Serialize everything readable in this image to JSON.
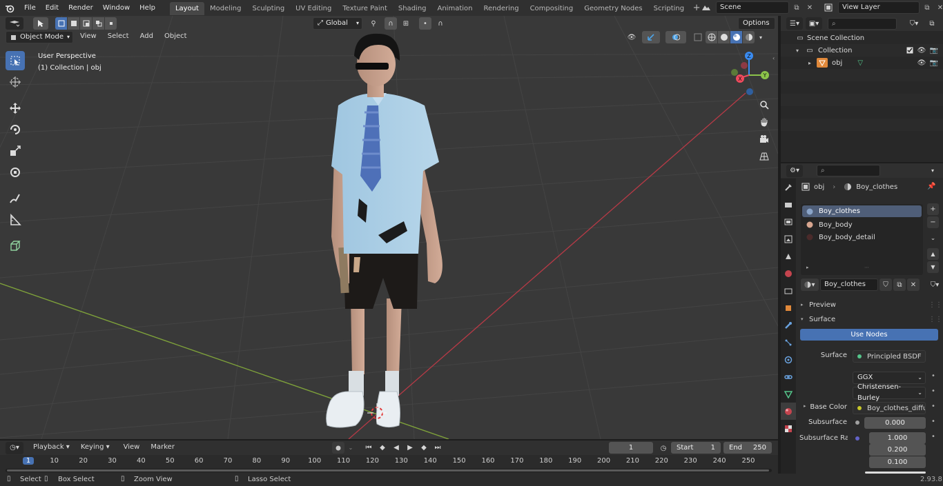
{
  "topbar": {
    "menus": [
      "File",
      "Edit",
      "Render",
      "Window",
      "Help"
    ],
    "workspaces": [
      "Layout",
      "Modeling",
      "Sculpting",
      "UV Editing",
      "Texture Paint",
      "Shading",
      "Animation",
      "Rendering",
      "Compositing",
      "Geometry Nodes",
      "Scripting"
    ],
    "active_workspace": "Layout",
    "scene": "Scene",
    "view_layer": "View Layer"
  },
  "viewport": {
    "mode": "Object Mode",
    "menus": [
      "View",
      "Select",
      "Add",
      "Object"
    ],
    "transform_orientation": "Global",
    "options_label": "Options",
    "overlay_title": "User Perspective",
    "overlay_sub": "(1) Collection | obj",
    "gizmo_axes": {
      "x": "X",
      "y": "Y",
      "z": "Z"
    },
    "tools": [
      "select-box",
      "cursor",
      "move",
      "rotate",
      "scale",
      "transform",
      "annotate",
      "measure",
      "add-cube"
    ]
  },
  "outliner": {
    "root": "Scene Collection",
    "collection": "Collection",
    "object": "obj"
  },
  "properties": {
    "breadcrumb_object": "obj",
    "breadcrumb_material": "Boy_clothes",
    "slots": [
      "Boy_clothes",
      "Boy_body",
      "Boy_body_detail"
    ],
    "material_name": "Boy_clothes",
    "preview_label": "Preview",
    "surface_label": "Surface",
    "use_nodes": "Use Nodes",
    "surface_field_label": "Surface",
    "surface_value": "Principled BSDF",
    "distribution": "GGX",
    "subsurface_method": "Christensen-Burley",
    "base_color_label": "Base Color",
    "base_color_value": "Boy_clothes_diffuse...",
    "subsurface_label": "Subsurface",
    "subsurface_value": "0.000",
    "subsurface_radius_label": "Subsurface Radi...",
    "radius": [
      "1.000",
      "0.200",
      "0.100"
    ]
  },
  "timeline": {
    "menus": [
      "Playback",
      "Keying",
      "View",
      "Marker"
    ],
    "current_frame": "1",
    "start_label": "Start",
    "start": "1",
    "end_label": "End",
    "end": "250",
    "ruler": [
      "1",
      "10",
      "20",
      "30",
      "40",
      "50",
      "60",
      "70",
      "80",
      "90",
      "100",
      "110",
      "120",
      "130",
      "140",
      "150",
      "160",
      "170",
      "180",
      "190",
      "200",
      "210",
      "220",
      "230",
      "240",
      "250"
    ]
  },
  "status": {
    "items": [
      "Select",
      "Box Select",
      "Zoom View",
      "Lasso Select"
    ],
    "version": "2.93.8"
  },
  "colors": {
    "accent": "#4772b3",
    "x_axis": "#f04a5d",
    "y_axis": "#8cc34a",
    "z_axis": "#3a8cf2"
  }
}
